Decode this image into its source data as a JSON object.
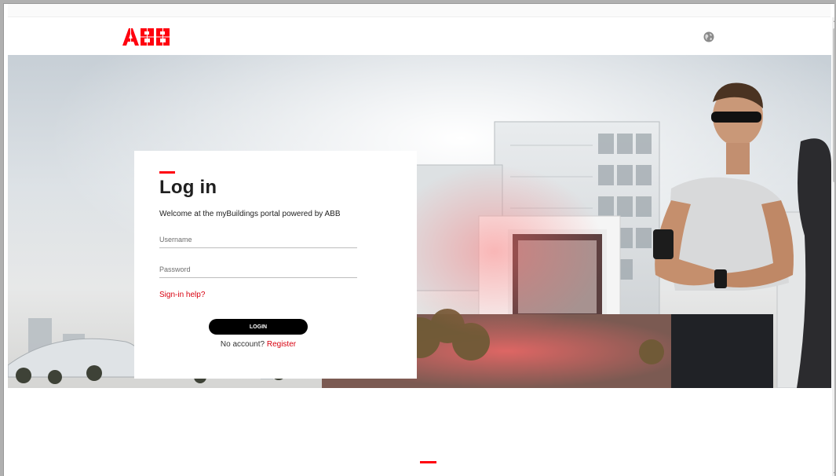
{
  "brand": {
    "logo_text": "ABB",
    "logo_color": "#ff000f"
  },
  "header": {
    "language_icon": "globe-icon"
  },
  "hero": {
    "image_description": "city buildings with runner checking watch"
  },
  "login": {
    "title": "Log in",
    "welcome": "Welcome at the myBuildings portal powered by ABB",
    "username_placeholder": "Username",
    "password_placeholder": "Password",
    "help_link": "Sign-in help?",
    "login_button": "LOGIN",
    "no_account": "No account?",
    "register_link": "Register"
  },
  "colors": {
    "accent": "#ff000f",
    "link": "#d8000f",
    "button": "#000000"
  }
}
